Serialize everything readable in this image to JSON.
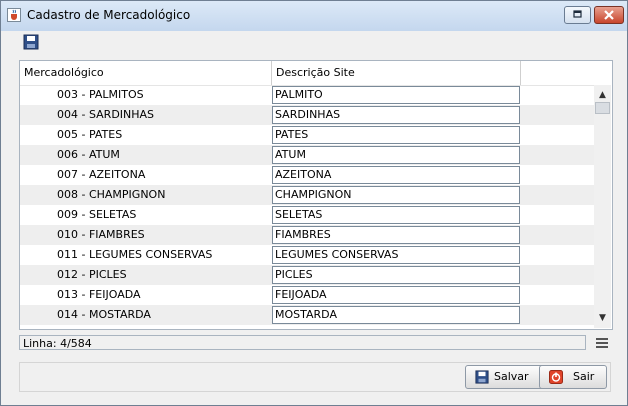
{
  "window": {
    "title": "Cadastro de Mercadológico"
  },
  "grid": {
    "columns": [
      "Mercadológico",
      "Descrição Site"
    ],
    "rows": [
      {
        "code": "003 - PALMITOS",
        "desc": "PALMITO"
      },
      {
        "code": "004 - SARDINHAS",
        "desc": "SARDINHAS"
      },
      {
        "code": "005 - PATES",
        "desc": "PATES"
      },
      {
        "code": "006 - ATUM",
        "desc": "ATUM"
      },
      {
        "code": "007 - AZEITONA",
        "desc": "AZEITONA"
      },
      {
        "code": "008 - CHAMPIGNON",
        "desc": "CHAMPIGNON"
      },
      {
        "code": "009 - SELETAS",
        "desc": "SELETAS"
      },
      {
        "code": "010 - FIAMBRES",
        "desc": "FIAMBRES"
      },
      {
        "code": "011 - LEGUMES CONSERVAS",
        "desc": "LEGUMES CONSERVAS"
      },
      {
        "code": "012 - PICLES",
        "desc": "PICLES"
      },
      {
        "code": "013 - FEIJOADA",
        "desc": "FEIJOADA"
      },
      {
        "code": "014 - MOSTARDA",
        "desc": "MOSTARDA"
      }
    ]
  },
  "status": {
    "text": "Linha: 4/584"
  },
  "buttons": {
    "save": "Salvar",
    "exit": "Sair"
  },
  "icons": {
    "app": "java-cup-icon",
    "toolbar_save": "floppy-disk-icon",
    "status_menu": "menu-lines-icon",
    "exit": "power-icon"
  },
  "colors": {
    "titlebar": "#c4d7ee",
    "close": "#c8452c",
    "row_alt": "#eeeeee"
  }
}
